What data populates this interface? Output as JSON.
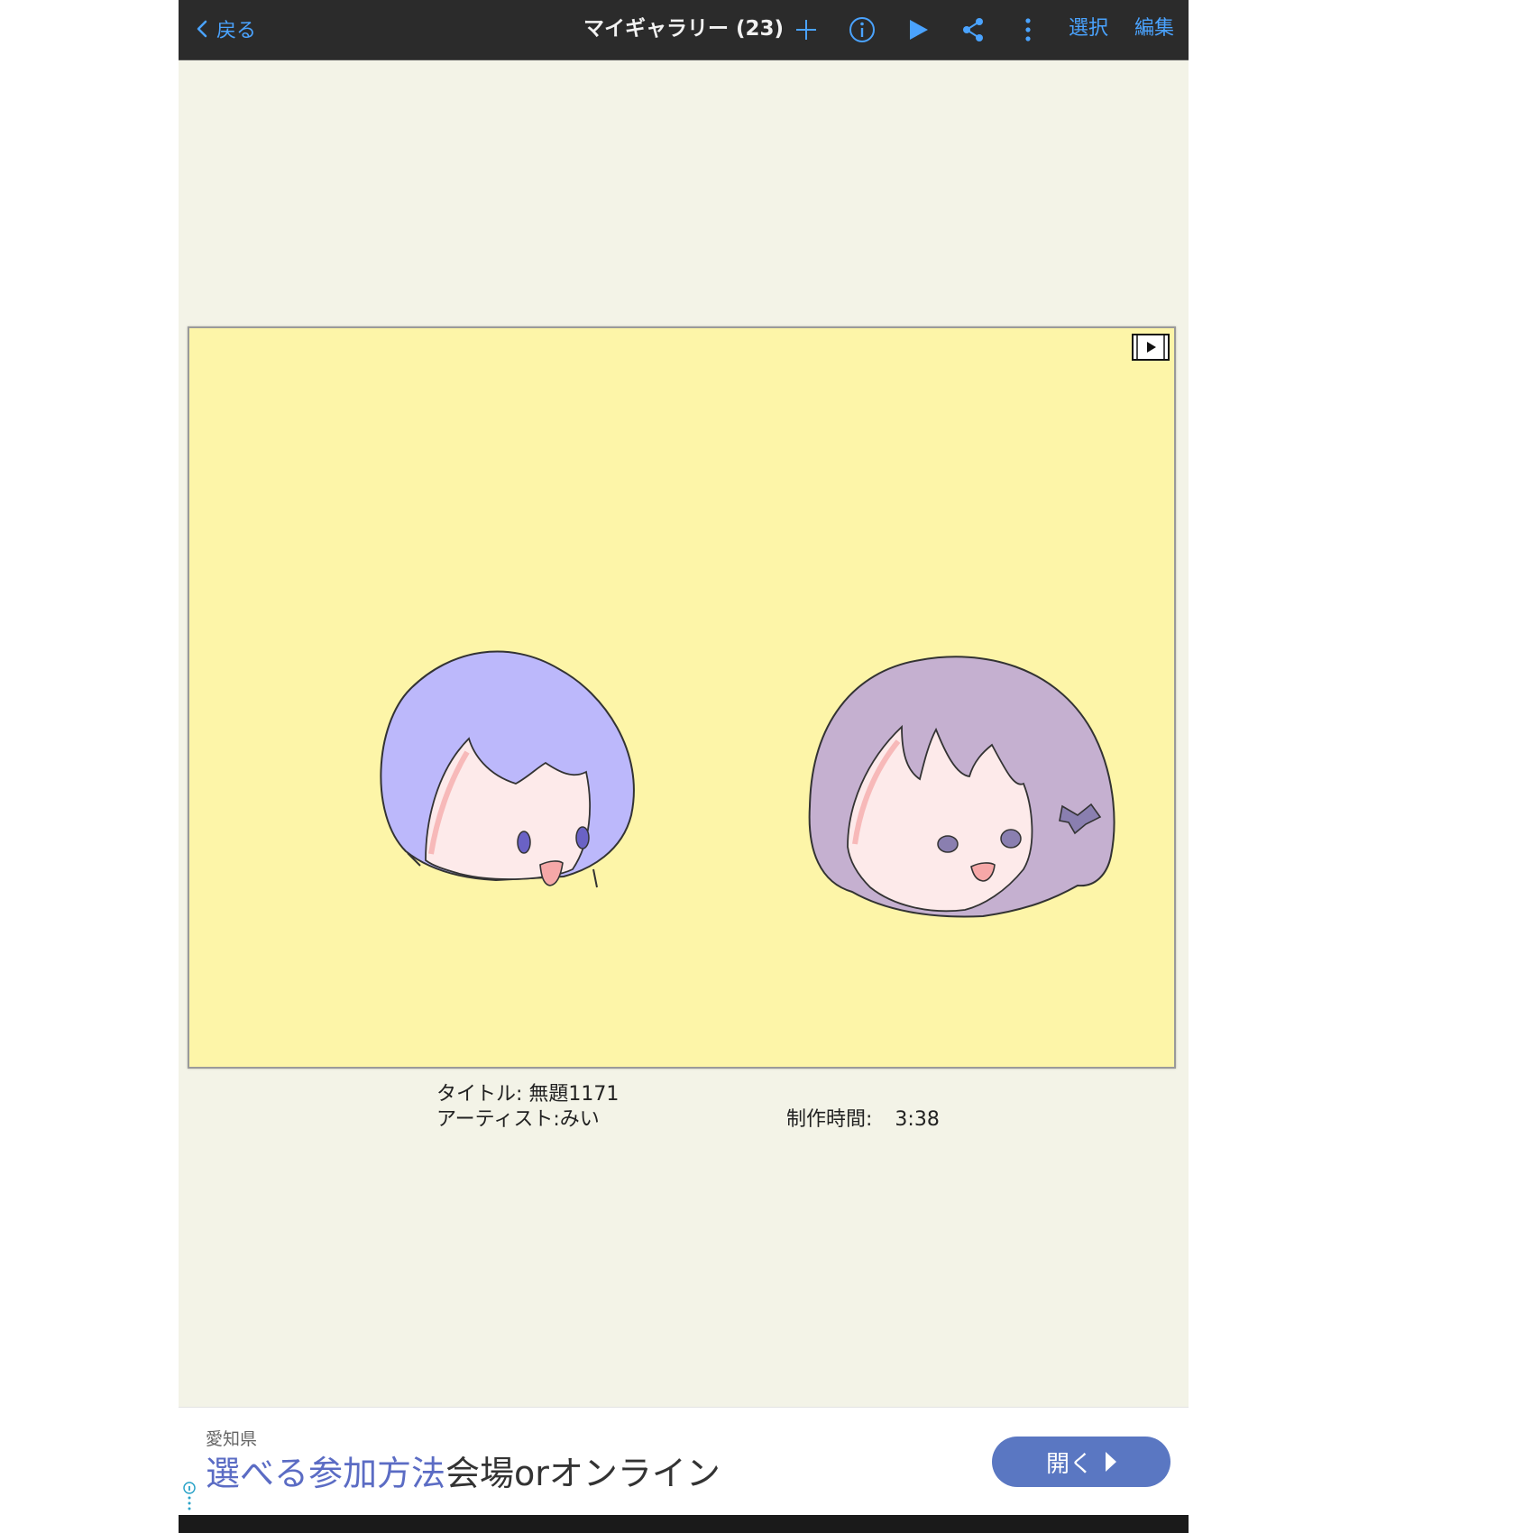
{
  "topbar": {
    "back_label": "戻る",
    "title": "マイギャラリー (23)",
    "select_label": "選択",
    "edit_label": "編集",
    "accent_color": "#4aa3ff"
  },
  "artwork": {
    "background_color": "#fdf5a8",
    "title_line": "タイトル: 無題1171",
    "artist_line": "アーティスト:みい",
    "time_label": "制作時間:",
    "time_value": "3:38"
  },
  "ad": {
    "region": "愛知県",
    "headline_highlight": "選べる参加方法",
    "headline_rest": "会場orオンライン",
    "open_label": "開く",
    "button_color": "#5a77c2"
  }
}
